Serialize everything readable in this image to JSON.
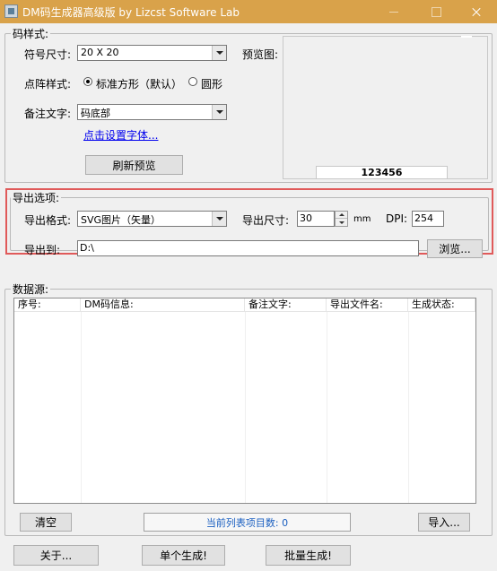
{
  "window": {
    "title": "DM码生成器高级版  by Lizcst Software Lab"
  },
  "style_group": {
    "label": "码样式:",
    "symbol_size_label": "符号尺寸:",
    "symbol_size_value": "20 X 20",
    "dot_style_label": "点阵样式:",
    "dot_style_options": [
      "标准方形（默认）",
      "圆形"
    ],
    "dot_style_selected": 0,
    "note_text_label": "备注文字:",
    "note_text_value": "码底部",
    "font_link": "点击设置字体...",
    "refresh_button": "刷新预览",
    "preview_label": "预览图:",
    "preview_code": "123456"
  },
  "export_group": {
    "label": "导出选项:",
    "format_label": "导出格式:",
    "format_value": "SVG图片（矢量）",
    "size_label": "导出尺寸:",
    "size_value": "30",
    "size_unit": "mm",
    "dpi_label": "DPI:",
    "dpi_value": "254",
    "export_to_label": "导出到:",
    "export_to_value": "D:\\",
    "browse_button": "浏览..."
  },
  "data_group": {
    "label": "数据源:",
    "columns": [
      "序号:",
      "DM码信息:",
      "备注文字:",
      "导出文件名:",
      "生成状态:"
    ],
    "rows": [],
    "clear_button": "清空",
    "status_text": "当前列表项目数: 0",
    "import_button": "导入..."
  },
  "bottom": {
    "about_button": "关于...",
    "single_button": "单个生成!",
    "batch_button": "批量生成!"
  },
  "colors": {
    "titlebar": "#d9a24a",
    "highlight": "#e05a5a",
    "link": "#0000ee",
    "status_text": "#1a5fc0"
  }
}
